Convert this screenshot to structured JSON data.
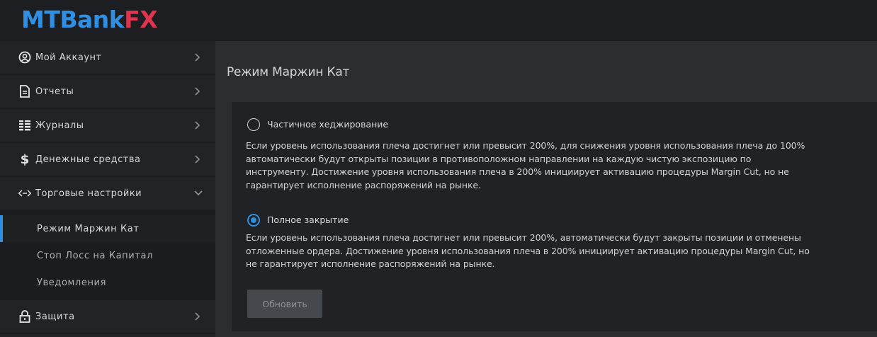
{
  "brand": {
    "part1": "MTBank",
    "part2": "FX"
  },
  "sidebar": {
    "items": [
      {
        "label": "Мой Аккаунт",
        "icon": "user-circle-icon"
      },
      {
        "label": "Отчеты",
        "icon": "document-icon"
      },
      {
        "label": "Журналы",
        "icon": "journal-list-icon"
      },
      {
        "label": "Денежные средства",
        "icon": "dollar-icon"
      },
      {
        "label": "Торговые настройки",
        "icon": "code-arrows-icon",
        "expanded": true
      },
      {
        "label": "Защита",
        "icon": "lock-icon"
      }
    ],
    "subitems": [
      {
        "label": "Режим Маржин Кат",
        "active": true
      },
      {
        "label": "Стоп Лосс на Капитал"
      },
      {
        "label": "Уведомления"
      }
    ]
  },
  "main": {
    "title": "Режим Маржин Кат",
    "options": [
      {
        "label": "Частичное хеджирование",
        "checked": false,
        "description": "Если уровень использования плеча достигнет или превысит 200%, для снижения уровня использования плеча до 100% автоматически будут открыты позиции в противоположном направлении на каждую чистую экспозицию по инструменту. Достижение уровня использования плеча в 200% инициирует активацию процедуры Margin Cut, но не гарантирует исполнение распоряжений на рынке."
      },
      {
        "label": "Полное закрытие",
        "checked": true,
        "description": "Если уровень использования плеча достигнет или превысит 200%, автоматически будут закрыты позиции и отменены отложенные ордера. Достижение уровня использования плеча в 200% инициирует активацию процедуры Margin Cut, но не гарантирует исполнение распоряжений на рынке."
      }
    ],
    "button_label": "Обновить"
  },
  "colors": {
    "accent": "#2f8fe3",
    "brand_red": "#e0344e",
    "sidebar_bg": "#212326",
    "content_bg": "#2b2d30"
  }
}
